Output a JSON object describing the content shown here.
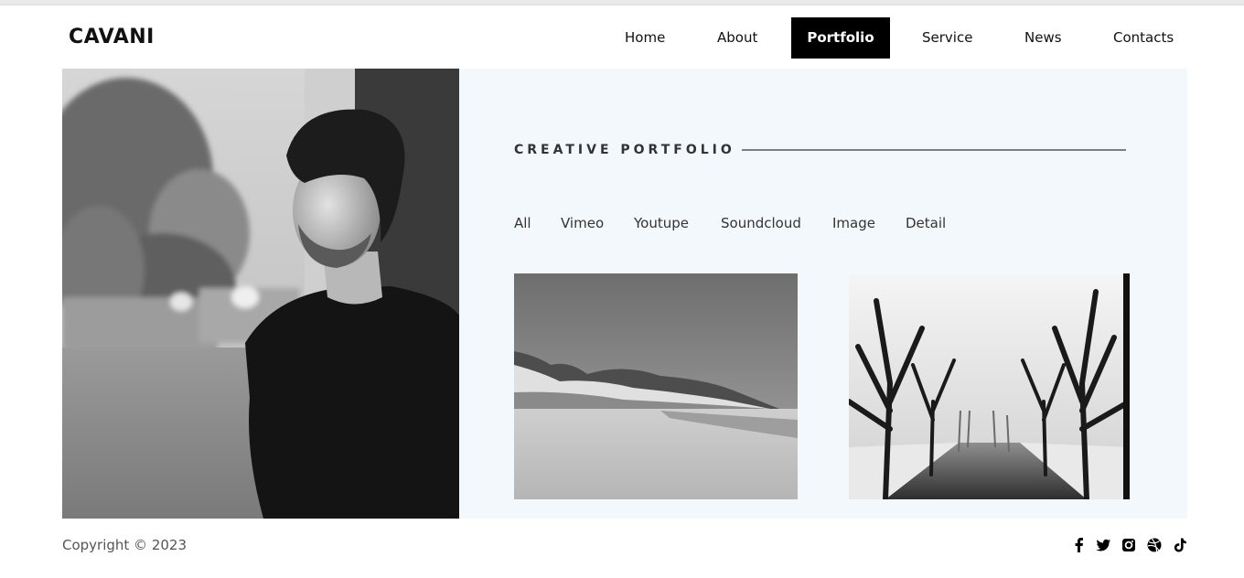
{
  "brand": {
    "logo": "CAVANI"
  },
  "nav": {
    "items": [
      {
        "label": "Home",
        "active": false
      },
      {
        "label": "About",
        "active": false
      },
      {
        "label": "Portfolio",
        "active": true
      },
      {
        "label": "Service",
        "active": false
      },
      {
        "label": "News",
        "active": false
      },
      {
        "label": "Contacts",
        "active": false
      }
    ]
  },
  "hero": {
    "photo": "black-and-white portrait of a man leaning on a wall"
  },
  "portfolio": {
    "section_title": "CREATIVE PORTFOLIO",
    "filters": [
      "All",
      "Vimeo",
      "Youtupe",
      "Soundcloud",
      "Image",
      "Detail"
    ],
    "items": [
      {
        "image": "black-and-white beach with cliffs"
      },
      {
        "image": "black-and-white tree-lined park alley in fog"
      }
    ]
  },
  "footer": {
    "copyright": "Copyright © 2023",
    "social_icons": [
      "facebook-icon",
      "twitter-icon",
      "instagram-icon",
      "dribbble-icon",
      "tiktok-icon"
    ]
  },
  "colors": {
    "accent": "#000000",
    "panel_bg": "#f3f8fd",
    "divider": "#7b7f86"
  }
}
